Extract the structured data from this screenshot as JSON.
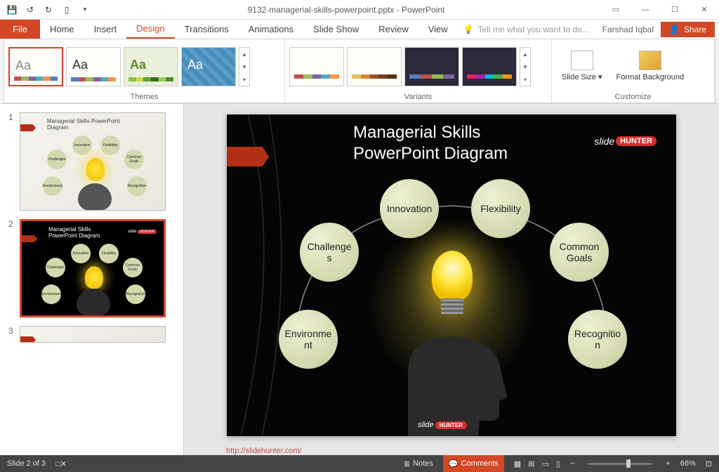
{
  "titleBar": {
    "docTitle": "9132-managerial-skills-powerpoint.pptx - PowerPoint"
  },
  "ribbon": {
    "fileTab": "File",
    "tabs": [
      "Home",
      "Insert",
      "Design",
      "Transitions",
      "Animations",
      "Slide Show",
      "Review",
      "View"
    ],
    "activeTab": "Design",
    "tellMe": "Tell me what you want to do...",
    "userName": "Farshad Iqbal",
    "share": "Share",
    "groups": {
      "themes": "Themes",
      "variants": "Variants",
      "customize": "Customize",
      "slideSize": "Slide Size",
      "formatBg": "Format Background"
    }
  },
  "slide": {
    "title1": "Managerial Skills",
    "title2": "PowerPoint Diagram",
    "logoText": "slide",
    "logoBadge": "HUNTER",
    "bubbles": [
      "Innovation",
      "Flexibility",
      "Challenges",
      "Common Goals",
      "Environment",
      "Recognition"
    ],
    "url": "http://slidehunter.com/"
  },
  "thumbs": {
    "miniBubbles": [
      "Innovation",
      "Flexibility",
      "Challenges",
      "Common Goals",
      "Environment",
      "Recognition"
    ],
    "count": 3,
    "selected": 2
  },
  "statusBar": {
    "slideInfo": "Slide 2 of 3",
    "notes": "Notes",
    "comments": "Comments",
    "zoom": "66%"
  },
  "colors": {
    "accent": "#d24726",
    "swatches": [
      "#c0504d",
      "#9bbb59",
      "#8064a2",
      "#4bacc6",
      "#f79646",
      "#4f81bd"
    ]
  }
}
